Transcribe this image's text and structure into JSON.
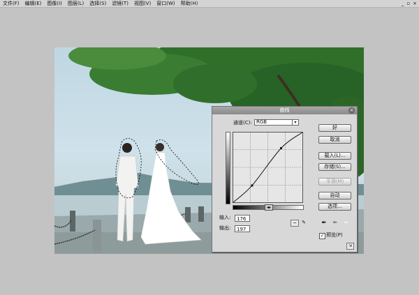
{
  "menubar": {
    "items": [
      "文件(F)",
      "编辑(E)",
      "图像(I)",
      "图层(L)",
      "选择(S)",
      "滤镜(T)",
      "视图(V)",
      "窗口(W)",
      "帮助(H)"
    ],
    "window_controls": [
      "_",
      "▫",
      "×"
    ]
  },
  "curves_dialog": {
    "title": "曲线",
    "close_glyph": "×",
    "channel_label": "通道(C):",
    "channel_value": "RGB",
    "channel_arrow": "▾",
    "slider_glyph": "◂▸",
    "input_label": "输入:",
    "input_value": "176",
    "output_label": "输出:",
    "output_value": "197",
    "curve_points_tool": "~",
    "pencil_tool": "✎",
    "buttons": {
      "ok": "好",
      "cancel": "取消",
      "load": "载入(L)...",
      "save": "存储(S)...",
      "smooth": "平滑(M)",
      "auto": "自动",
      "options": "选项..."
    },
    "preview_checked": true,
    "preview_check_glyph": "✓",
    "preview_label": "预览(P)",
    "corner_glyph": "⇲",
    "eyedroppers": [
      {
        "icon": "black-eyedropper-icon",
        "glyph": "✒",
        "color": "#111111"
      },
      {
        "icon": "gray-eyedropper-icon",
        "glyph": "✒",
        "color": "#777777"
      },
      {
        "icon": "white-eyedropper-icon",
        "glyph": "✒",
        "color": "#eeeeee"
      }
    ],
    "curve": {
      "points": [
        [
          0,
          0
        ],
        [
          70,
          62
        ],
        [
          176,
          197
        ],
        [
          255,
          255
        ]
      ]
    }
  },
  "colors": {
    "foliage": "#2f6f2a",
    "sky": "#cfe1ea",
    "sea": "#b6c8cd"
  }
}
